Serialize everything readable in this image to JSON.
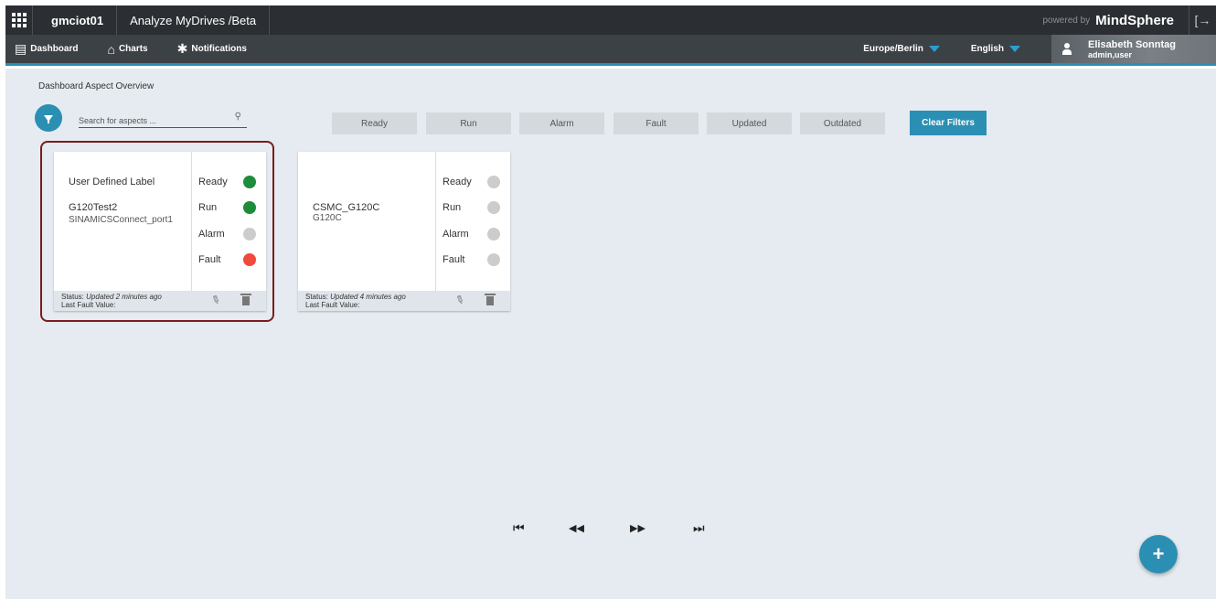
{
  "header": {
    "tenant": "gmciot01",
    "app_name": "Analyze MyDrives /Beta",
    "powered_by": "powered by",
    "brand": "MindSphere"
  },
  "nav": {
    "items": [
      {
        "label": "Dashboard",
        "icon": "dashboard-icon"
      },
      {
        "label": "Charts",
        "icon": "charts-icon"
      },
      {
        "label": "Notifications",
        "icon": "gear-icon"
      }
    ],
    "timezone": "Europe/Berlin",
    "language": "English",
    "user_name": "Elisabeth Sonntag",
    "user_role": "admin,user"
  },
  "page": {
    "title": "Dashboard Aspect Overview",
    "search_placeholder": "Search for aspects ..."
  },
  "filters": [
    "Ready",
    "Run",
    "Alarm",
    "Fault",
    "Updated",
    "Outdated"
  ],
  "clear_filters": "Clear Filters",
  "cards": [
    {
      "label": "User Defined Label",
      "name": "G120Test2",
      "sub": "SINAMICSConnect_port1",
      "statuses": [
        {
          "name": "Ready",
          "color": "#1e8c3a"
        },
        {
          "name": "Run",
          "color": "#1e8c3a"
        },
        {
          "name": "Alarm",
          "color": "#cccccc"
        },
        {
          "name": "Fault",
          "color": "#f04a3e"
        }
      ],
      "status_prefix": "Status:",
      "status_text": "Updated 2 minutes ago",
      "last_fault": "Last Fault Value:"
    },
    {
      "label": "",
      "name": "CSMC_G120C",
      "sub": "G120C",
      "statuses": [
        {
          "name": "Ready",
          "color": "#cccccc"
        },
        {
          "name": "Run",
          "color": "#cccccc"
        },
        {
          "name": "Alarm",
          "color": "#cccccc"
        },
        {
          "name": "Fault",
          "color": "#cccccc"
        }
      ],
      "status_prefix": "Status:",
      "status_text": "Updated 4 minutes ago",
      "last_fault": "Last Fault Value:"
    }
  ],
  "pager": {
    "first": "⏮",
    "prev": "◀◀",
    "next": "▶▶",
    "last": "⏭"
  },
  "fab": "+"
}
